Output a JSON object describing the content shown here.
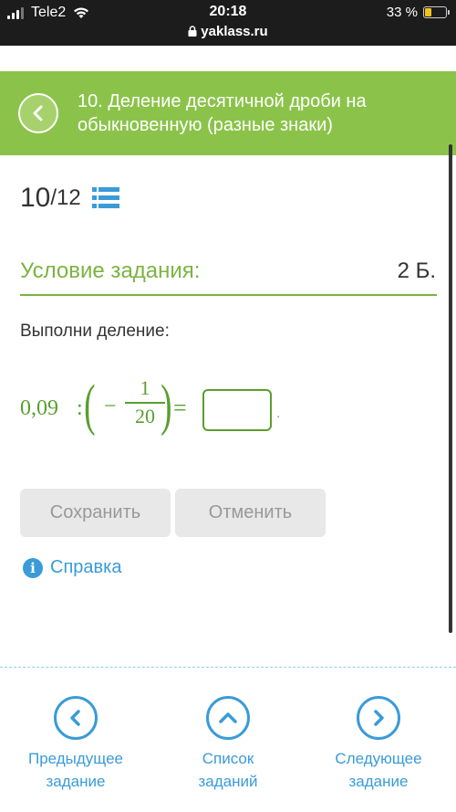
{
  "status_bar": {
    "carrier": "Tele2",
    "time": "20:18",
    "url": "yaklass.ru",
    "battery": "33 %",
    "battery_level": 0.33
  },
  "header": {
    "title": "10. Деление десятичной дроби на обыкновенную (разные знаки)"
  },
  "progress": {
    "current": "10",
    "total": "/12"
  },
  "condition": {
    "title": "Условие задания:",
    "points": "2 Б."
  },
  "task": {
    "instruction": "Выполни деление:",
    "dividend": "0,09",
    "operator": ":",
    "open_paren": "(",
    "minus": "−",
    "numerator": "1",
    "denominator": "20",
    "close_paren": ")",
    "equals": "=",
    "answer_value": "",
    "trailing": "."
  },
  "buttons": {
    "save": "Сохранить",
    "cancel": "Отменить"
  },
  "help": {
    "label": "Справка",
    "icon_glyph": "i"
  },
  "nav": {
    "prev": [
      "Предыдущее",
      "задание"
    ],
    "list": [
      "Список",
      "заданий"
    ],
    "next": [
      "Следующее",
      "задание"
    ]
  },
  "colors": {
    "header_green": "#8bc34a",
    "accent_green": "#7cb342",
    "link_blue": "#3a9bd8",
    "button_gray": "#e8e8e8"
  }
}
